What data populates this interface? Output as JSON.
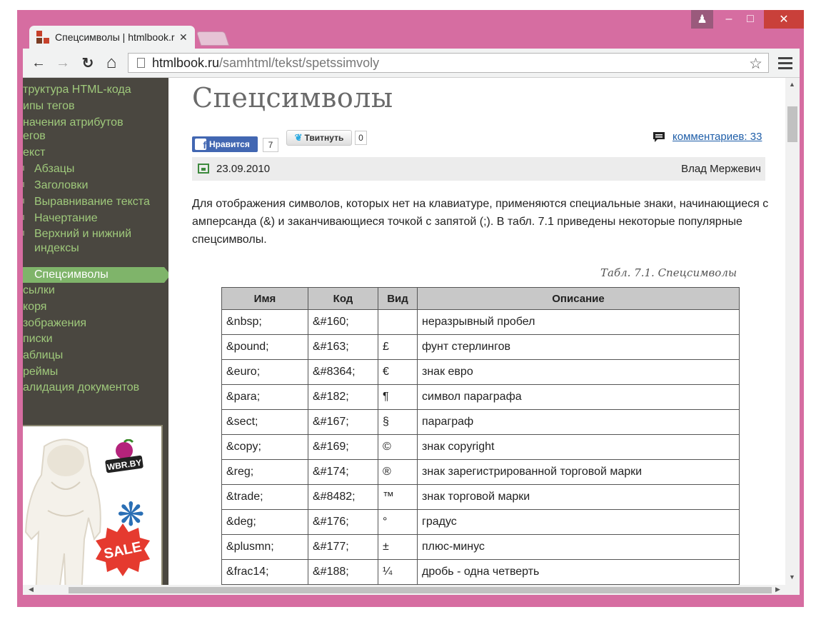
{
  "window": {
    "controls": {
      "user": "♟",
      "minimize": "–",
      "maximize": "□",
      "close": "✕"
    },
    "accent": "#d66da1"
  },
  "tab": {
    "title": "Спецсимволы | htmlbook.ru",
    "close": "✕"
  },
  "toolbar": {
    "back": "←",
    "forward": "→",
    "reload": "↻",
    "home": "⌂",
    "url_host": "htmlbook.ru",
    "url_path": "/samhtml/tekst/spetssimvoly",
    "bookmark": "☆"
  },
  "sidebar": {
    "items": [
      {
        "label": "труктура HTML-кода"
      },
      {
        "label": "ипы тегов"
      },
      {
        "label": "начения атрибутов"
      },
      {
        "label": "егов"
      },
      {
        "label": "екст"
      }
    ],
    "sub_items": [
      {
        "label": "Абзацы"
      },
      {
        "label": "Заголовки"
      },
      {
        "label": "Выравнивание текста"
      },
      {
        "label": "Начертание"
      },
      {
        "label": "Верхний и нижний"
      },
      {
        "label": "индексы"
      }
    ],
    "active": "Спецсимволы",
    "items_after": [
      {
        "label": "сылки"
      },
      {
        "label": "коря"
      },
      {
        "label": "зображения"
      },
      {
        "label": "писки"
      },
      {
        "label": "аблицы"
      },
      {
        "label": "реймы"
      },
      {
        "label": "алидация документов"
      }
    ],
    "ad": {
      "logo_text": "WBR.BY",
      "sale_text": "SALE",
      "flake": "❋"
    }
  },
  "content": {
    "title": "Спецсимволы",
    "facebook": {
      "label": "Нравится",
      "count": "7",
      "icon": "f"
    },
    "twitter": {
      "label": "Твитнуть",
      "count": "0",
      "icon": "🐦"
    },
    "comments": "комментариев: 33",
    "date": "23.09.2010",
    "author": "Влад Мержевич",
    "intro": "Для отображения символов, которых нет на клавиатуре, применяются специальные знаки, начинающиеся с амперсанда (&) и заканчивающиеся точкой с запятой (;). В табл. 7.1 приведены некоторые популярные спецсимволы.",
    "caption": "Табл. 7.1. Спецсимволы",
    "table": {
      "headers": [
        "Имя",
        "Код",
        "Вид",
        "Описание"
      ],
      "rows": [
        [
          "&nbsp;",
          "&#160;",
          "",
          "неразрывный пробел"
        ],
        [
          "&pound;",
          "&#163;",
          "£",
          "фунт стерлингов"
        ],
        [
          "&euro;",
          "&#8364;",
          "€",
          "знак евро"
        ],
        [
          "&para;",
          "&#182;",
          "¶",
          "символ параграфа"
        ],
        [
          "&sect;",
          "&#167;",
          "§",
          "параграф"
        ],
        [
          "&copy;",
          "&#169;",
          "©",
          "знак copyright"
        ],
        [
          "&reg;",
          "&#174;",
          "®",
          "знак зарегистрированной торговой марки"
        ],
        [
          "&trade;",
          "&#8482;",
          "™",
          "знак торговой марки"
        ],
        [
          "&deg;",
          "&#176;",
          "°",
          "градус"
        ],
        [
          "&plusmn;",
          "&#177;",
          "±",
          "плюс-минус"
        ],
        [
          "&frac14;",
          "&#188;",
          "¼",
          "дробь - одна четверть"
        ]
      ]
    }
  },
  "scrollbars": {
    "up": "▲",
    "down": "▼",
    "left": "◀",
    "right": "▶"
  }
}
